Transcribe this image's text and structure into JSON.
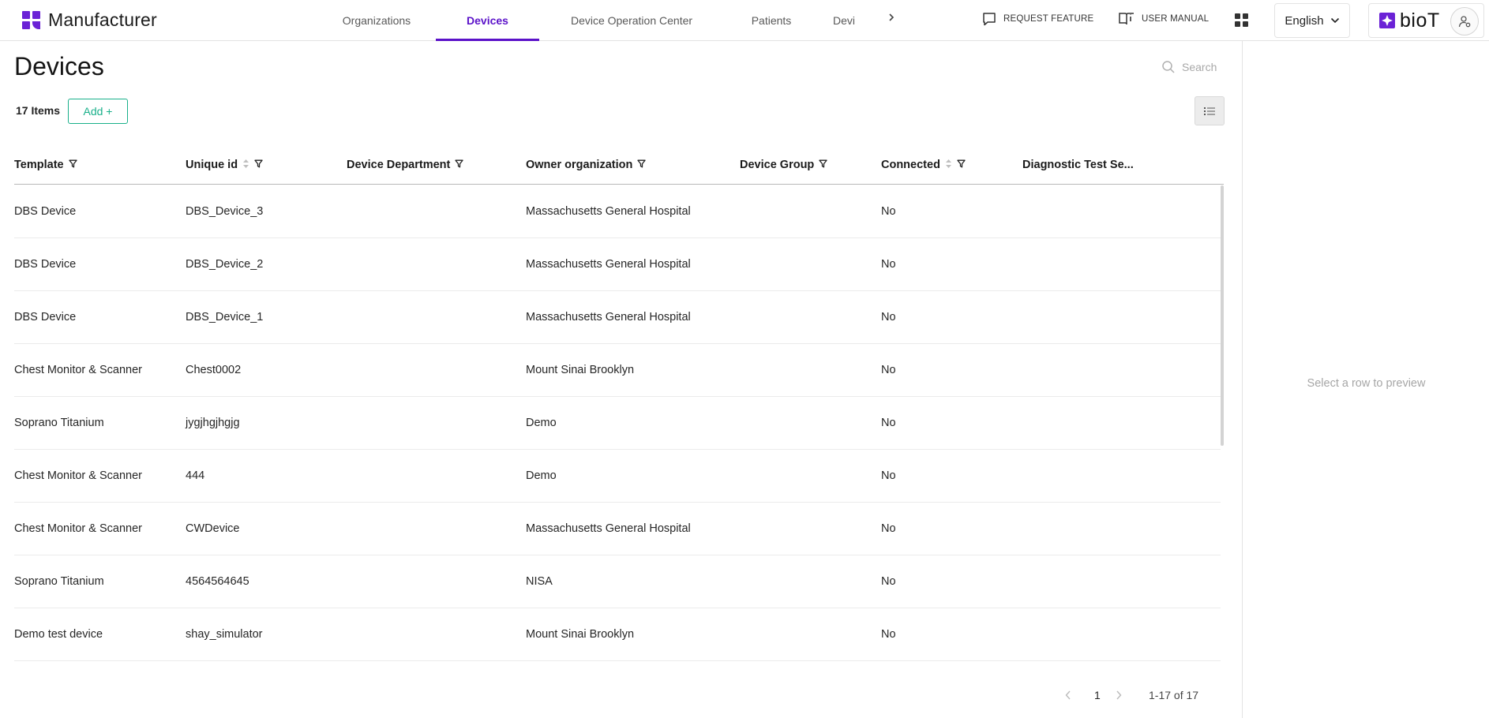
{
  "header": {
    "app_title": "Manufacturer",
    "nav_tabs": [
      {
        "label": "Organizations",
        "active": false
      },
      {
        "label": "Devices",
        "active": true
      },
      {
        "label": "Device Operation Center",
        "active": false
      },
      {
        "label": "Patients",
        "active": false
      },
      {
        "label": "Devi",
        "active": false
      }
    ],
    "nav_more_icon": "chevron-right-icon",
    "request_feature": "REQUEST FEATURE",
    "user_manual": "USER MANUAL",
    "language": "English",
    "brand": "bioT",
    "accent_color": "#5b12c9"
  },
  "main": {
    "title": "Devices",
    "search_placeholder": "Search",
    "items_count": "17 Items",
    "add_label": "Add +",
    "add_color": "#19b08a"
  },
  "table": {
    "columns": [
      {
        "label": "Template",
        "sortable": false,
        "filterable": true
      },
      {
        "label": "Unique id",
        "sortable": true,
        "filterable": true
      },
      {
        "label": "Device Department",
        "sortable": false,
        "filterable": true
      },
      {
        "label": "Owner organization",
        "sortable": false,
        "filterable": true
      },
      {
        "label": "Device Group",
        "sortable": false,
        "filterable": true
      },
      {
        "label": "Connected",
        "sortable": true,
        "filterable": true
      },
      {
        "label": "Diagnostic Test Se...",
        "sortable": false,
        "filterable": false
      }
    ],
    "rows": [
      [
        "DBS Device",
        "DBS_Device_3",
        "",
        "Massachusetts General Hospital",
        "",
        "No",
        ""
      ],
      [
        "DBS Device",
        "DBS_Device_2",
        "",
        "Massachusetts General Hospital",
        "",
        "No",
        ""
      ],
      [
        "DBS Device",
        "DBS_Device_1",
        "",
        "Massachusetts General Hospital",
        "",
        "No",
        ""
      ],
      [
        "Chest Monitor & Scanner",
        "Chest0002",
        "",
        "Mount Sinai Brooklyn",
        "",
        "No",
        ""
      ],
      [
        "Soprano Titanium",
        "jygjhgjhgjg",
        "",
        "Demo",
        "",
        "No",
        ""
      ],
      [
        "Chest Monitor & Scanner",
        "444",
        "",
        "Demo",
        "",
        "No",
        ""
      ],
      [
        "Chest Monitor & Scanner",
        "CWDevice",
        "",
        "Massachusetts General Hospital",
        "",
        "No",
        ""
      ],
      [
        "Soprano Titanium",
        "4564564645",
        "",
        "NISA",
        "",
        "No",
        ""
      ],
      [
        "Demo test device",
        "shay_simulator",
        "",
        "Mount Sinai Brooklyn",
        "",
        "No",
        ""
      ]
    ]
  },
  "pagination": {
    "current_page": "1",
    "range": "1-17 of 17"
  },
  "preview": {
    "empty_text": "Select a row to preview"
  }
}
